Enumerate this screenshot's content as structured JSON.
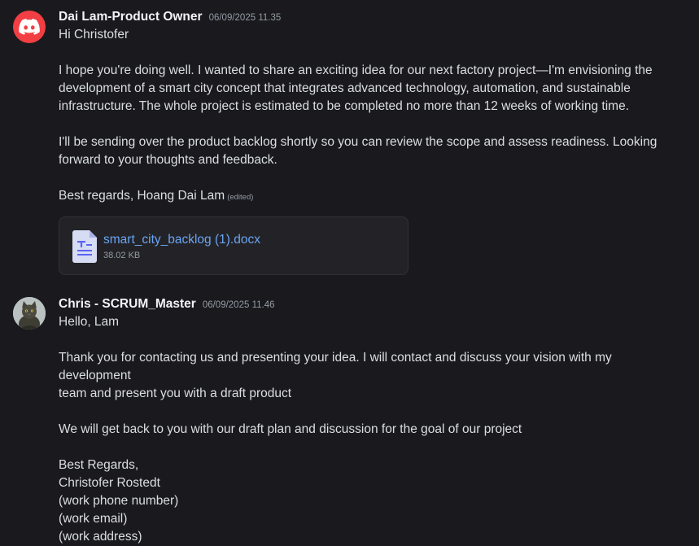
{
  "messages": [
    {
      "author": "Dai Lam-Product Owner",
      "timestamp": "06/09/2025 11.35",
      "avatar_icon": "discord-logo-icon",
      "lines": [
        "Hi Christofer",
        "",
        "I hope you're doing well. I wanted to share an exciting idea for our next factory project—I'm envisioning the",
        "development of a smart city concept that integrates advanced technology, automation, and sustainable",
        "infrastructure. The whole project is estimated to be completed no more than 12 weeks of working time.",
        "",
        "I'll be sending over the product backlog shortly so you can review the scope and assess readiness. Looking",
        "forward to your thoughts and feedback.",
        "",
        "Best regards, Hoang Dai Lam"
      ],
      "edited_label": "(edited)",
      "attachment": {
        "file_name": "smart_city_backlog (1).docx",
        "file_size": "38.02 KB",
        "icon": "document-file-icon"
      }
    },
    {
      "author": "Chris - SCRUM_Master",
      "timestamp": "06/09/2025 11.46",
      "avatar_icon": "cat-avatar",
      "lines": [
        "Hello, Lam",
        "",
        "Thank you for contacting us and presenting your idea. I will contact and discuss your vision with my development",
        "team and present you with a draft product",
        "",
        "We will get back to you with our draft plan and discussion for the goal of our project",
        "",
        "Best Regards,",
        "Christofer Rostedt",
        "(work phone number)",
        "(work email)",
        "(work address)"
      ]
    }
  ],
  "colors": {
    "background": "#1a1a1e",
    "text": "#dbdee1",
    "author": "#f2f3f5",
    "muted": "#949ba4",
    "link": "#6aa4f2",
    "discord_red": "#f23f43",
    "attachment_bg": "#232327"
  }
}
